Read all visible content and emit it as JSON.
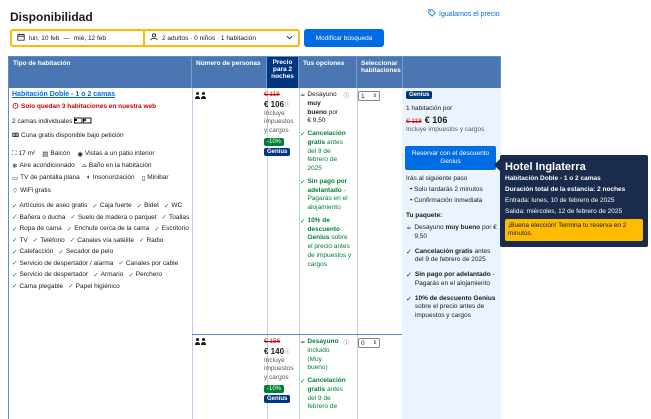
{
  "page": {
    "title": "Disponibilidad",
    "price_match": "Igualamos el precio"
  },
  "search": {
    "checkin": "lun, 10 feb",
    "checkout": "mié, 12 feb",
    "separator": "—",
    "guests": "2 adultos · 0 niños · 1 habitación",
    "button": "Modificar búsqueda"
  },
  "table": {
    "headers": {
      "room_type": "Tipo de habitación",
      "persons": "Número de personas",
      "price": "Precio para 2 noches",
      "options": "Tus opciones",
      "select": "Seleccionar habitaciones"
    }
  },
  "room": {
    "name": "Habitación Doble - 1 o 2 camas",
    "scarcity": "Solo quedan 3 habitaciones en nuestra web",
    "beds": "2 camas individuales",
    "crib": "Cuna gratis disponible bajo petición",
    "facilities": [
      [
        "17 m²",
        "Balcón",
        "Vistas a un patio interior"
      ],
      [
        "Aire acondicionado",
        "Baño en la habitación"
      ],
      [
        "TV de pantalla plana",
        "Insonorización",
        "Minibar"
      ],
      [
        "WiFi gratis"
      ]
    ],
    "amenities": [
      "Artículos de aseo gratis",
      "Caja fuerte",
      "Bidet",
      "WC",
      "Bañera o ducha",
      "Suelo de madera o parquet",
      "Toallas",
      "Ropa de cama",
      "Enchufe cerca de la cama",
      "Escritorio",
      "TV",
      "Teléfono",
      "Canales vía satélite",
      "Radio",
      "Calefacción",
      "Secador de pelo",
      "Servicio de despertador / alarma",
      "Canales por cable",
      "Servicio de despertador",
      "Armario",
      "Perchero",
      "Cama plegable",
      "Papel higiénico"
    ]
  },
  "offer1": {
    "old_price": "€ 118",
    "price": "€ 106",
    "taxes": "Incluye impuestos y cargos",
    "discount": "-10%",
    "genius": "Genius",
    "breakfast_pre": "Desayuno",
    "breakfast_bold": "muy bueno",
    "breakfast_post": "por € 9,50",
    "cancel_bold": "Cancelación gratis",
    "cancel_rest": "antes del 9 de febrero de 2025",
    "prepay_bold": "Sin pago por adelantado",
    "prepay_rest": "- Pagarás en el alojamiento",
    "genius_bold": "10% de descuento Genius",
    "genius_rest": "sobre el precio antes de impuestos y cargos",
    "qty": "1"
  },
  "offer2": {
    "old_price": "€ 156",
    "price": "€ 140",
    "taxes": "Incluye impuestos y cargos",
    "discount": "-10%",
    "genius": "Genius",
    "breakfast_bold": "Desayuno",
    "breakfast_rest": "incluido (Muy bueno)",
    "cancel_bold": "Cancelación gratis",
    "cancel_rest": "antes del 9 de febrero de",
    "qty": "0"
  },
  "summary": {
    "genius": "Genius",
    "rooms_for": "1 habitación por",
    "old_price": "€ 118",
    "price": "€ 106",
    "taxes": "Incluye impuestos y cargos",
    "reserve_button": "Reservar con el descuento Genius",
    "next_step": "Irás al siguiente paso",
    "bullets": [
      "Solo tardarás 2 minutos",
      "Confirmación inmediata"
    ],
    "package_title": "Tu paquete:",
    "pkg_breakfast_pre": "Desayuno",
    "pkg_breakfast_bold": "muy bueno",
    "pkg_breakfast_post": "por € 9,50",
    "pkg_cancel_bold": "Cancelación gratis",
    "pkg_cancel_rest": "antes del 9 de febrero de 2025",
    "pkg_prepay_bold": "Sin pago por adelantado",
    "pkg_prepay_rest": "- Pagarás en el alojamiento",
    "pkg_genius_pre": "10% de descuento",
    "pkg_genius_bold": "Genius",
    "pkg_genius_rest": "sobre el precio antes de impuestos y cargos"
  },
  "tooltip": {
    "hotel": "Hotel Inglaterra",
    "room": "Habitación Doble - 1 o 2 camas",
    "duration": "Duración total de la estancia: 2 noches",
    "checkin": "Entrada: lunes, 10 de febrero de 2025",
    "checkout": "Salida: miércoles, 12 de febrero de 2025",
    "promo": "¡Buena elección! Termina tu reserva en 2 minutos."
  },
  "colors": {
    "header_blue": "#4c76b2",
    "dark_blue": "#003580",
    "link_blue": "#006ce4",
    "yellow": "#febb02",
    "green": "#008234",
    "red": "#cc0000"
  }
}
